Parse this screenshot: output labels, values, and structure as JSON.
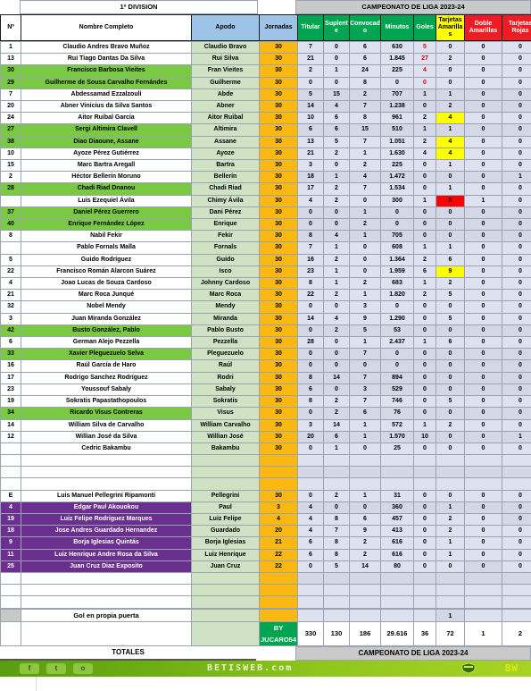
{
  "titles": {
    "division": "1ª DIVISION",
    "campeonato": "CAMPEONATO  DE LIGA 2023-24",
    "totales": "TOTALES",
    "campeonato_footer": "CAMPEONATO  DE LIGA 2023-24"
  },
  "headers": {
    "num": "Nº",
    "nombre": "Nombre Completo",
    "apodo": "Apodo",
    "jornadas": "Jornadas",
    "titular": "Titular",
    "suplente": "Suplente",
    "convocado": "Convocado",
    "minutos": "Minutos",
    "goles": "Goles",
    "amarillas": "Tarjetas Amarillas",
    "dobles": "Doble Amarillas",
    "rojas": "Tarjetas Rojas"
  },
  "colors": {
    "header_green": "#00a551",
    "header_blue": "#9dc3e6",
    "header_yellow": "#ffff00",
    "header_red": "#ee1c25",
    "row_green": "#7ac943",
    "row_purple": "#6b2f8f",
    "nick_green": "#cfe2c4",
    "jornadas_orange": "#fcb812",
    "stat_lilac": "#dde1f0",
    "goles_red_text": "#e00000",
    "footer_green": "#8fc61c"
  },
  "rows": [
    {
      "num": "1",
      "nombre": "Claudio Andres Bravo Muñoz",
      "apodo": "Claudio Bravo",
      "jor": "30",
      "tit": "7",
      "sup": "0",
      "con": "6",
      "min": "630",
      "gol": "5",
      "ama": "0",
      "dob": "0",
      "roj": "0",
      "style": "plain",
      "gk": true
    },
    {
      "num": "13",
      "nombre": "Rui Tiago Dantas Da Silva",
      "apodo": "Rui Silva",
      "jor": "30",
      "tit": "21",
      "sup": "0",
      "con": "6",
      "min": "1.845",
      "gol": "27",
      "ama": "2",
      "dob": "0",
      "roj": "0",
      "style": "plain",
      "gk": true
    },
    {
      "num": "30",
      "nombre": "Francisco Barbosa Vieites",
      "apodo": "Fran Vieites",
      "jor": "30",
      "tit": "2",
      "sup": "1",
      "con": "24",
      "min": "225",
      "gol": "4",
      "ama": "0",
      "dob": "0",
      "roj": "0",
      "style": "green",
      "gk": true
    },
    {
      "num": "29",
      "nombre": "Guilherme de Sousa Carvalho Fernándes",
      "apodo": "Guilherme",
      "jor": "30",
      "tit": "0",
      "sup": "0",
      "con": "8",
      "min": "0",
      "gol": "0",
      "ama": "0",
      "dob": "0",
      "roj": "0",
      "style": "green",
      "gk": true
    },
    {
      "num": "7",
      "nombre": "Abdessamad Ezzalzouli",
      "apodo": "Abde",
      "jor": "30",
      "tit": "5",
      "sup": "15",
      "con": "2",
      "min": "707",
      "gol": "1",
      "ama": "1",
      "dob": "0",
      "roj": "0",
      "style": "plain",
      "alt": true
    },
    {
      "num": "20",
      "nombre": "Abner Vinicius da Silva Santos",
      "apodo": "Abner",
      "jor": "30",
      "tit": "14",
      "sup": "4",
      "con": "7",
      "min": "1.238",
      "gol": "0",
      "ama": "2",
      "dob": "0",
      "roj": "0",
      "style": "plain",
      "alt": true
    },
    {
      "num": "24",
      "nombre": "Aitor Ruibal García",
      "apodo": "Aitor Ruibal",
      "jor": "30",
      "tit": "10",
      "sup": "6",
      "con": "8",
      "min": "961",
      "gol": "2",
      "ama": "4",
      "dob": "0",
      "roj": "0",
      "style": "plain",
      "amaflag": "yellow"
    },
    {
      "num": "27",
      "nombre": "Sergi Altimira Clavell",
      "apodo": "Altimira",
      "jor": "30",
      "tit": "6",
      "sup": "6",
      "con": "15",
      "min": "510",
      "gol": "1",
      "ama": "1",
      "dob": "0",
      "roj": "0",
      "style": "green",
      "alt": true
    },
    {
      "num": "38",
      "nombre": "Diao Diaoune, Assane",
      "apodo": "Assane",
      "jor": "30",
      "tit": "13",
      "sup": "5",
      "con": "7",
      "min": "1.051",
      "gol": "2",
      "ama": "4",
      "dob": "0",
      "roj": "0",
      "style": "green",
      "amaflag": "yellow"
    },
    {
      "num": "10",
      "nombre": "Ayoze Pérez Gutiérrez",
      "apodo": "Ayoze",
      "jor": "30",
      "tit": "21",
      "sup": "2",
      "con": "1",
      "min": "1.630",
      "gol": "4",
      "ama": "4",
      "dob": "0",
      "roj": "0",
      "style": "plain",
      "amaflag": "yellow"
    },
    {
      "num": "15",
      "nombre": "Marc Bartra Aregall",
      "apodo": "Bartra",
      "jor": "30",
      "tit": "3",
      "sup": "0",
      "con": "2",
      "min": "225",
      "gol": "0",
      "ama": "1",
      "dob": "0",
      "roj": "0",
      "style": "plain"
    },
    {
      "num": "2",
      "nombre": "Héctor Bellerín Moruno",
      "apodo": "Bellerín",
      "jor": "30",
      "tit": "18",
      "sup": "1",
      "con": "4",
      "min": "1.472",
      "gol": "0",
      "ama": "0",
      "dob": "0",
      "roj": "1",
      "style": "plain",
      "alt": true
    },
    {
      "num": "28",
      "nombre": "Chadi Riad Dnanou",
      "apodo": "Chadi Riad",
      "jor": "30",
      "tit": "17",
      "sup": "2",
      "con": "7",
      "min": "1.534",
      "gol": "0",
      "ama": "1",
      "dob": "0",
      "roj": "0",
      "style": "green"
    },
    {
      "num": "",
      "nombre": "Luis Ezequiel Ávila",
      "apodo": "Chimy Ávila",
      "jor": "30",
      "tit": "4",
      "sup": "2",
      "con": "0",
      "min": "300",
      "gol": "1",
      "ama": "5",
      "dob": "1",
      "roj": "0",
      "style": "plain",
      "amaflag": "red"
    },
    {
      "num": "37",
      "nombre": "Daniel Pérez Guerrero",
      "apodo": "Dani Pérez",
      "jor": "30",
      "tit": "0",
      "sup": "0",
      "con": "1",
      "min": "0",
      "gol": "0",
      "ama": "0",
      "dob": "0",
      "roj": "0",
      "style": "green",
      "alt": true
    },
    {
      "num": "40",
      "nombre": "Enrique Fernández López",
      "apodo": "Enrique",
      "jor": "30",
      "tit": "0",
      "sup": "0",
      "con": "2",
      "min": "0",
      "gol": "0",
      "ama": "0",
      "dob": "0",
      "roj": "0",
      "style": "green",
      "alt": true
    },
    {
      "num": "8",
      "nombre": "Nabil Fekir",
      "apodo": "Fekir",
      "jor": "30",
      "tit": "8",
      "sup": "4",
      "con": "1",
      "min": "705",
      "gol": "0",
      "ama": "0",
      "dob": "0",
      "roj": "0",
      "style": "plain",
      "alt": true
    },
    {
      "num": "",
      "nombre": "Pablo Fornals Malla",
      "apodo": "Fornals",
      "jor": "30",
      "tit": "7",
      "sup": "1",
      "con": "0",
      "min": "608",
      "gol": "1",
      "ama": "1",
      "dob": "0",
      "roj": "0",
      "style": "plain"
    },
    {
      "num": "5",
      "nombre": "Guido Rodríguez",
      "apodo": "Guido",
      "jor": "30",
      "tit": "16",
      "sup": "2",
      "con": "0",
      "min": "1.364",
      "gol": "2",
      "ama": "6",
      "dob": "0",
      "roj": "0",
      "style": "plain"
    },
    {
      "num": "22",
      "nombre": "Francisco Román Alarcon Suárez",
      "apodo": "Isco",
      "jor": "30",
      "tit": "23",
      "sup": "1",
      "con": "0",
      "min": "1.959",
      "gol": "6",
      "ama": "9",
      "dob": "0",
      "roj": "0",
      "style": "plain",
      "amaflag": "yellow"
    },
    {
      "num": "4",
      "nombre": "Joao Lucas de Souza Cardoso",
      "apodo": "Johnny Cardoso",
      "jor": "30",
      "tit": "8",
      "sup": "1",
      "con": "2",
      "min": "683",
      "gol": "1",
      "ama": "2",
      "dob": "0",
      "roj": "0",
      "style": "plain"
    },
    {
      "num": "21",
      "nombre": "Marc Roca Junqué",
      "apodo": "Marc Roca",
      "jor": "30",
      "tit": "22",
      "sup": "2",
      "con": "1",
      "min": "1.820",
      "gol": "2",
      "ama": "5",
      "dob": "0",
      "roj": "0",
      "style": "plain"
    },
    {
      "num": "32",
      "nombre": "Nobel Mendy",
      "apodo": "Mendy",
      "jor": "30",
      "tit": "0",
      "sup": "0",
      "con": "3",
      "min": "0",
      "gol": "0",
      "ama": "0",
      "dob": "0",
      "roj": "0",
      "style": "plain"
    },
    {
      "num": "3",
      "nombre": "Juan Miranda González",
      "apodo": "Miranda",
      "jor": "30",
      "tit": "14",
      "sup": "4",
      "con": "9",
      "min": "1.290",
      "gol": "0",
      "ama": "5",
      "dob": "0",
      "roj": "0",
      "style": "plain"
    },
    {
      "num": "42",
      "nombre": "Busto González, Pablo",
      "apodo": "Pablo Busto",
      "jor": "30",
      "tit": "0",
      "sup": "2",
      "con": "5",
      "min": "53",
      "gol": "0",
      "ama": "0",
      "dob": "0",
      "roj": "0",
      "style": "green",
      "alt": true
    },
    {
      "num": "6",
      "nombre": "German Alejo Pezzella",
      "apodo": "Pezzella",
      "jor": "30",
      "tit": "28",
      "sup": "0",
      "con": "1",
      "min": "2.437",
      "gol": "1",
      "ama": "6",
      "dob": "0",
      "roj": "0",
      "style": "plain"
    },
    {
      "num": "33",
      "nombre": "Xavier Pleguezuelo Selva",
      "apodo": "Pleguezuelo",
      "jor": "30",
      "tit": "0",
      "sup": "0",
      "con": "7",
      "min": "0",
      "gol": "0",
      "ama": "0",
      "dob": "0",
      "roj": "0",
      "style": "green",
      "alt": true
    },
    {
      "num": "16",
      "nombre": "Raúl García de Haro",
      "apodo": "Raúl",
      "jor": "30",
      "tit": "0",
      "sup": "0",
      "con": "0",
      "min": "0",
      "gol": "0",
      "ama": "0",
      "dob": "0",
      "roj": "0",
      "style": "plain",
      "alt": true
    },
    {
      "num": "17",
      "nombre": "Rodrigo Sanchez Rodríguez",
      "apodo": "Rodri",
      "jor": "30",
      "tit": "8",
      "sup": "14",
      "con": "7",
      "min": "894",
      "gol": "0",
      "ama": "0",
      "dob": "0",
      "roj": "0",
      "style": "plain",
      "alt": true
    },
    {
      "num": "23",
      "nombre": "Youssouf Sabaly",
      "apodo": "Sabaly",
      "jor": "30",
      "tit": "6",
      "sup": "0",
      "con": "3",
      "min": "529",
      "gol": "0",
      "ama": "0",
      "dob": "0",
      "roj": "0",
      "style": "plain",
      "alt": true
    },
    {
      "num": "19",
      "nombre": "Sokratis Papastathopoulos",
      "apodo": "Sokratis",
      "jor": "30",
      "tit": "8",
      "sup": "2",
      "con": "7",
      "min": "746",
      "gol": "0",
      "ama": "5",
      "dob": "0",
      "roj": "0",
      "style": "plain"
    },
    {
      "num": "34",
      "nombre": "Ricardo Visus Contreras",
      "apodo": "Visus",
      "jor": "30",
      "tit": "0",
      "sup": "2",
      "con": "6",
      "min": "76",
      "gol": "0",
      "ama": "0",
      "dob": "0",
      "roj": "0",
      "style": "green",
      "alt": true
    },
    {
      "num": "14",
      "nombre": "William Silva de Carvalho",
      "apodo": "William Carvalho",
      "jor": "30",
      "tit": "3",
      "sup": "14",
      "con": "1",
      "min": "572",
      "gol": "1",
      "ama": "2",
      "dob": "0",
      "roj": "0",
      "style": "plain"
    },
    {
      "num": "12",
      "nombre": "Willian José da Silva",
      "apodo": "Willian José",
      "jor": "30",
      "tit": "20",
      "sup": "6",
      "con": "1",
      "min": "1.570",
      "gol": "10",
      "ama": "0",
      "dob": "0",
      "roj": "1",
      "style": "plain",
      "alt": true
    },
    {
      "num": "",
      "nombre": "Cedric Bakambu",
      "apodo": "Bakambu",
      "jor": "30",
      "tit": "0",
      "sup": "1",
      "con": "0",
      "min": "25",
      "gol": "0",
      "ama": "0",
      "dob": "0",
      "roj": "0",
      "style": "plain"
    },
    {
      "num": "",
      "nombre": "",
      "apodo": "",
      "jor": "",
      "tit": "",
      "sup": "",
      "con": "",
      "min": "",
      "gol": "",
      "ama": "",
      "dob": "",
      "roj": "",
      "style": "blank"
    },
    {
      "num": "",
      "nombre": "",
      "apodo": "",
      "jor": "",
      "tit": "",
      "sup": "",
      "con": "",
      "min": "",
      "gol": "",
      "ama": "",
      "dob": "",
      "roj": "",
      "style": "blank",
      "alt": true
    },
    {
      "num": "",
      "nombre": "",
      "apodo": "",
      "jor": "",
      "tit": "",
      "sup": "",
      "con": "",
      "min": "",
      "gol": "",
      "ama": "",
      "dob": "",
      "roj": "",
      "style": "blank"
    },
    {
      "num": "E",
      "nombre": "Luis Manuel Pellegrini Ripamonti",
      "apodo": "Pellegrini",
      "jor": "30",
      "tit": "0",
      "sup": "2",
      "con": "1",
      "min": "31",
      "gol": "0",
      "ama": "0",
      "dob": "0",
      "roj": "0",
      "style": "plain"
    },
    {
      "num": "4",
      "nombre": "Edgar Paul Akouokou",
      "apodo": "Paul",
      "jor": "3",
      "tit": "4",
      "sup": "0",
      "con": "0",
      "min": "360",
      "gol": "0",
      "ama": "1",
      "dob": "0",
      "roj": "0",
      "style": "purple",
      "alt": true
    },
    {
      "num": "19",
      "nombre": "Luiz Felipe Rodriguez Marques",
      "apodo": "Luiz Felipe",
      "jor": "4",
      "tit": "4",
      "sup": "8",
      "con": "6",
      "min": "457",
      "gol": "0",
      "ama": "2",
      "dob": "0",
      "roj": "0",
      "style": "purple",
      "rojalt": true
    },
    {
      "num": "18",
      "nombre": "Jose Andres Guardado Hernandez",
      "apodo": "Guardado",
      "jor": "20",
      "tit": "4",
      "sup": "7",
      "con": "9",
      "min": "413",
      "gol": "0",
      "ama": "2",
      "dob": "0",
      "roj": "0",
      "style": "purple"
    },
    {
      "num": "9",
      "nombre": "Borja Iglesias Quintás",
      "apodo": "Borja Iglesias",
      "jor": "21",
      "tit": "6",
      "sup": "8",
      "con": "2",
      "min": "616",
      "gol": "0",
      "ama": "1",
      "dob": "0",
      "roj": "0",
      "style": "purple"
    },
    {
      "num": "11",
      "nombre": "Luiz Henrique Andre Rosa da Silva",
      "apodo": "Luiz Henrique",
      "jor": "22",
      "tit": "6",
      "sup": "8",
      "con": "2",
      "min": "616",
      "gol": "0",
      "ama": "1",
      "dob": "0",
      "roj": "0",
      "style": "purple"
    },
    {
      "num": "25",
      "nombre": "Juan Cruz Diaz Exposito",
      "apodo": "Juan Cruz",
      "jor": "22",
      "tit": "0",
      "sup": "5",
      "con": "14",
      "min": "80",
      "gol": "0",
      "ama": "0",
      "dob": "0",
      "roj": "0",
      "style": "purple",
      "dobalt": true
    },
    {
      "num": "",
      "nombre": "",
      "apodo": "",
      "jor": "",
      "tit": "",
      "sup": "",
      "con": "",
      "min": "",
      "gol": "",
      "ama": "",
      "dob": "",
      "roj": "",
      "style": "blank",
      "alt": true
    },
    {
      "num": "",
      "nombre": "",
      "apodo": "",
      "jor": "",
      "tit": "",
      "sup": "",
      "con": "",
      "min": "",
      "gol": "",
      "ama": "",
      "dob": "",
      "roj": "",
      "style": "blank"
    },
    {
      "num": "",
      "nombre": "",
      "apodo": "",
      "jor": "",
      "tit": "",
      "sup": "",
      "con": "",
      "min": "",
      "gol": "",
      "ama": "",
      "dob": "",
      "roj": "",
      "style": "blank"
    }
  ],
  "own_goal_row": {
    "label": "Gol en propia puerta",
    "goles": "",
    "amarillas": "1"
  },
  "totals": {
    "credit": "BY JUCARO54",
    "titular": "330",
    "suplente": "130",
    "convocado": "186",
    "minutos": "29.616",
    "goles": "36",
    "amarillas": "72",
    "dobles": "1",
    "rojas": "2"
  },
  "footer": {
    "facebook": "f",
    "twitter": "t",
    "instagram": "o",
    "brand": "BETISWEB.com",
    "logo": "BW"
  }
}
